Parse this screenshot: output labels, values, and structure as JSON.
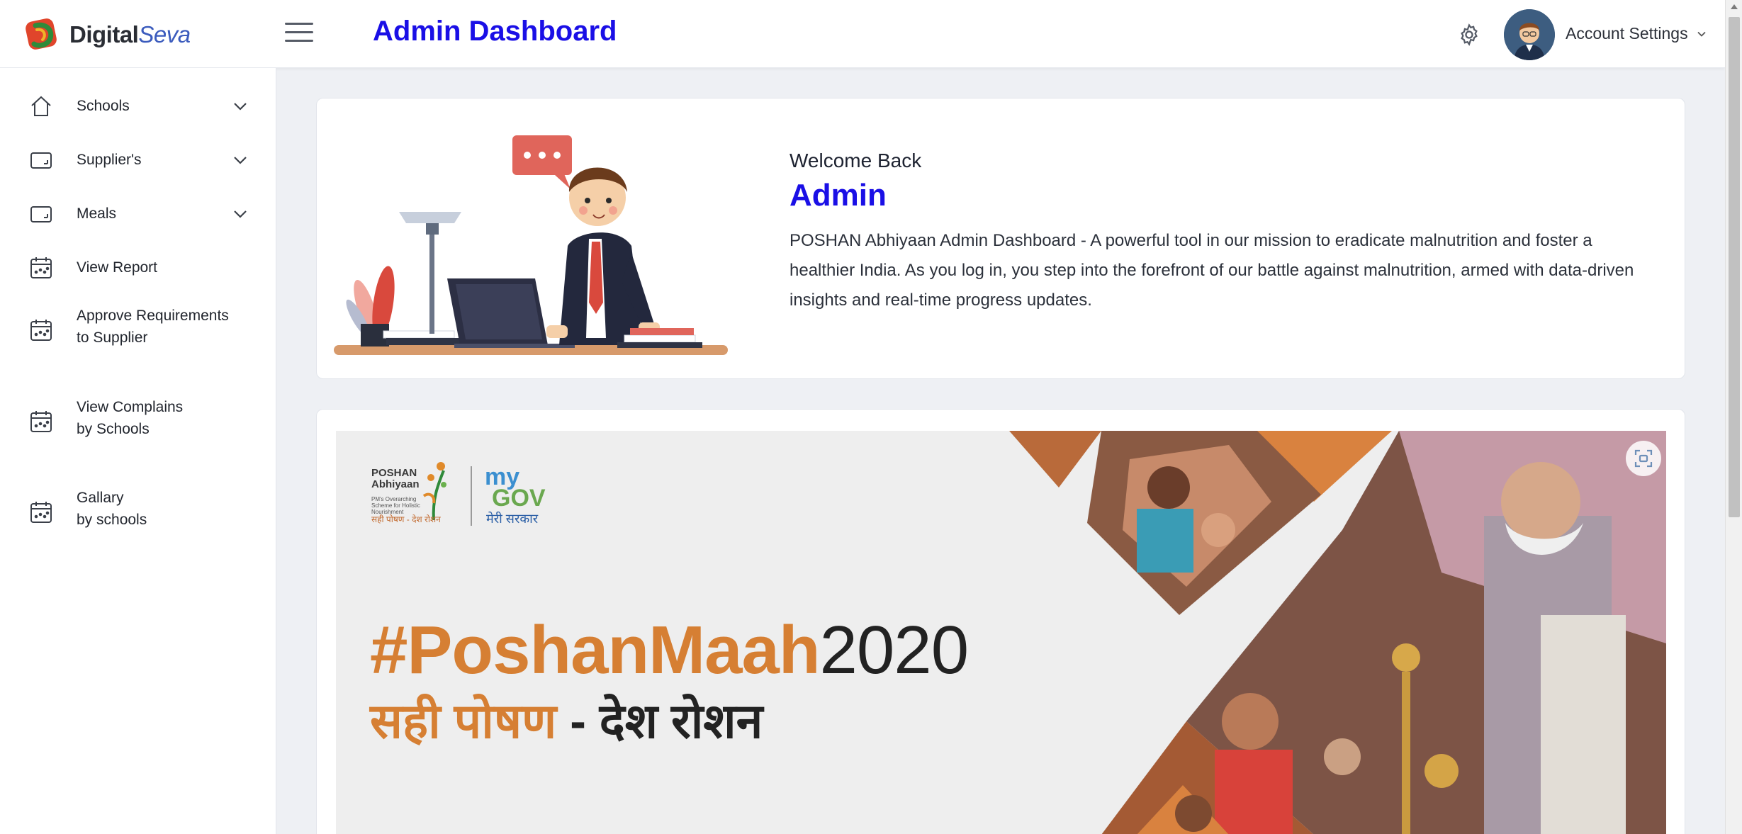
{
  "brand": {
    "name_bold": "Digital",
    "name_italic": "Seva"
  },
  "header": {
    "title": "Admin Dashboard",
    "account_label": "Account Settings"
  },
  "sidebar": {
    "items": [
      {
        "label": "Schools",
        "icon": "home-icon",
        "expandable": true
      },
      {
        "label": "Supplier's",
        "icon": "tablet-icon",
        "expandable": true
      },
      {
        "label": "Meals",
        "icon": "tablet-icon",
        "expandable": true
      },
      {
        "label": "View Report",
        "icon": "calendar-icon",
        "expandable": false
      },
      {
        "label_line1": "Approve Requirements",
        "label_line2": "to Supplier",
        "icon": "calendar-icon",
        "expandable": false
      },
      {
        "label_line1": "View Complains",
        "label_line2": "by Schools",
        "icon": "calendar-icon",
        "expandable": false
      },
      {
        "label_line1": "Gallary",
        "label_line2": "by schools",
        "icon": "calendar-icon",
        "expandable": false
      }
    ]
  },
  "welcome": {
    "greeting": "Welcome Back",
    "name": "Admin",
    "description": "POSHAN Abhiyaan Admin Dashboard - A powerful tool in our mission to eradicate malnutrition and foster a healthier India. As you log in, you step into the forefront of our battle against malnutrition, armed with data-driven insights and real-time progress updates."
  },
  "banner": {
    "hashtag": "#PoshanMaah",
    "year": "2020",
    "hindi_orange": "सही पोषण",
    "hindi_dark": " - देश रोशन",
    "poshan_title_1": "POSHAN",
    "poshan_title_2": "Abhiyaan",
    "poshan_sub": "PM's Overarching Scheme for Holistic Nourishment",
    "poshan_hindi": "सही पोषण - देश रोशन",
    "mygov_my": "my",
    "mygov_gov": "GOV",
    "mygov_hindi": "मेरी सरकार"
  },
  "colors": {
    "accent": "#1a0fe6",
    "banner_orange": "#d67f33",
    "sidebar_bg": "#ffffff",
    "page_bg": "#eef0f4"
  }
}
